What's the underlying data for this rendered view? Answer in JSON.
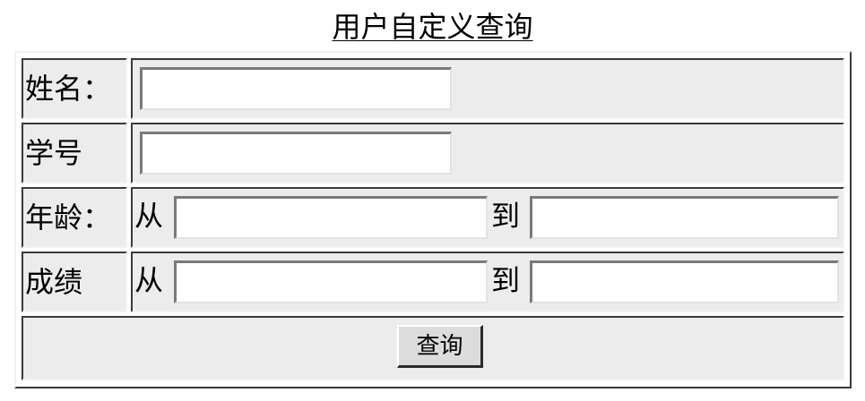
{
  "page": {
    "title": "用户自定义查询"
  },
  "form": {
    "name": {
      "label": "姓名：",
      "value": ""
    },
    "student_id": {
      "label": "学号",
      "value": ""
    },
    "age": {
      "label": "年龄：",
      "from_label": "从",
      "to_label": "到",
      "from_value": "",
      "to_value": ""
    },
    "score": {
      "label": "成绩",
      "from_label": "从",
      "to_label": "到",
      "from_value": "",
      "to_value": ""
    },
    "submit_label": "查询"
  }
}
